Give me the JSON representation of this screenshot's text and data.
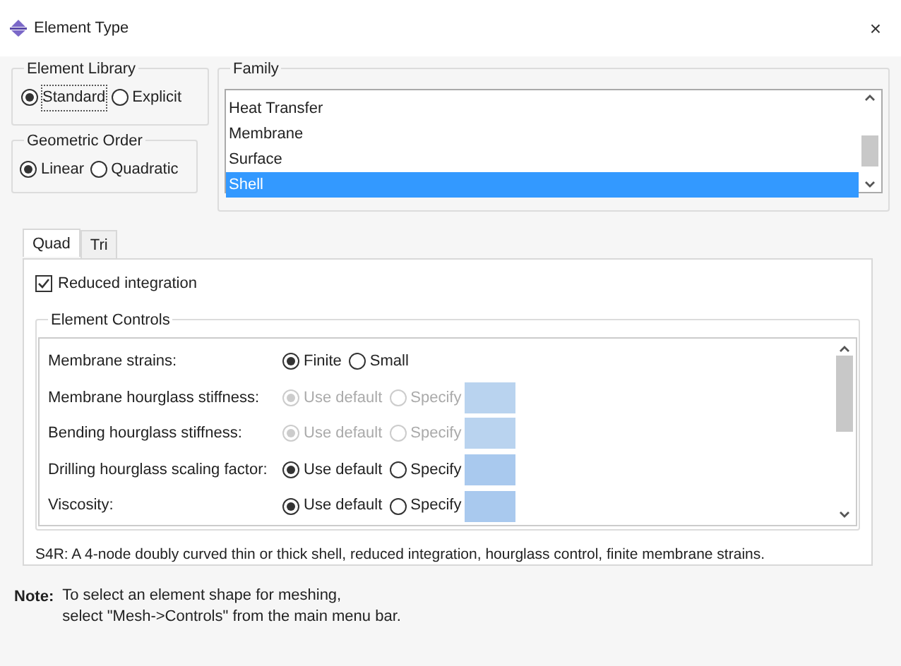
{
  "window": {
    "title": "Element Type",
    "close": "×"
  },
  "element_library": {
    "title": "Element Library",
    "options": [
      {
        "label": "Standard",
        "selected": true,
        "focused": true
      },
      {
        "label": "Explicit",
        "selected": false,
        "focused": false
      }
    ]
  },
  "geometric_order": {
    "title": "Geometric Order",
    "options": [
      {
        "label": "Linear",
        "selected": true
      },
      {
        "label": "Quadratic",
        "selected": false
      }
    ]
  },
  "family": {
    "title": "Family",
    "items": [
      {
        "label": "Heat Transfer",
        "selected": false
      },
      {
        "label": "Membrane",
        "selected": false
      },
      {
        "label": "Surface",
        "selected": false
      },
      {
        "label": "Shell",
        "selected": true
      }
    ]
  },
  "tabs": [
    {
      "label": "Quad",
      "selected": true
    },
    {
      "label": "Tri",
      "selected": false
    }
  ],
  "reduced_integration": {
    "label": "Reduced integration",
    "checked": true
  },
  "element_controls": {
    "title": "Element Controls",
    "rows": [
      {
        "kind": "choice",
        "label": "Membrane strains:",
        "disabled": false,
        "options": [
          {
            "label": "Finite",
            "selected": true
          },
          {
            "label": "Small",
            "selected": false
          }
        ]
      },
      {
        "kind": "value",
        "label": "Membrane hourglass stiffness:",
        "disabled": true,
        "options": [
          {
            "label": "Use default",
            "selected": true
          },
          {
            "label": "Specify",
            "selected": false
          }
        ]
      },
      {
        "kind": "value",
        "label": "Bending hourglass stiffness:",
        "disabled": true,
        "options": [
          {
            "label": "Use default",
            "selected": true
          },
          {
            "label": "Specify",
            "selected": false
          }
        ]
      },
      {
        "kind": "value",
        "label": "Drilling hourglass scaling factor:",
        "disabled": false,
        "options": [
          {
            "label": "Use default",
            "selected": true
          },
          {
            "label": "Specify",
            "selected": false
          }
        ]
      },
      {
        "kind": "value",
        "label": "Viscosity:",
        "disabled": false,
        "options": [
          {
            "label": "Use default",
            "selected": true
          },
          {
            "label": "Specify",
            "selected": false
          }
        ]
      }
    ]
  },
  "description": "S4R:  A 4-node doubly curved thin or thick shell, reduced integration, hourglass control, finite membrane strains.",
  "note": {
    "label": "Note:",
    "lines": [
      "To select an element shape for meshing,",
      "select \"Mesh->Controls\" from the main menu bar."
    ]
  }
}
